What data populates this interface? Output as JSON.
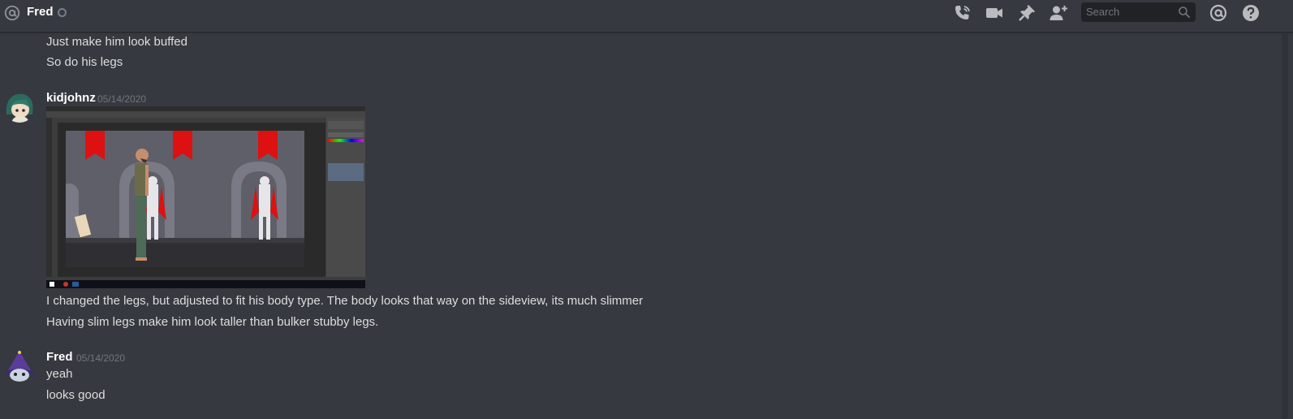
{
  "header": {
    "channel_name": "Fred",
    "search_placeholder": "Search",
    "icons": [
      "at-icon",
      "phone-call-icon",
      "video-icon",
      "pin-icon",
      "add-friend-icon",
      "search-icon",
      "mentions-icon",
      "help-icon"
    ]
  },
  "messages": {
    "prev_lines": [
      "Just make him look buffed",
      "So do his legs"
    ],
    "group1": {
      "username": "kidjohnz",
      "timestamp": "05/14/2020",
      "attachment_icon": "photoshop-screenshot-image",
      "lines": [
        "I changed the legs, but adjusted to fit his body type. The body looks that way on the sideview, its much slimmer",
        "Having slim legs make him look taller than bulker stubby legs."
      ]
    },
    "group2": {
      "username": "Fred",
      "timestamp": "05/14/2020",
      "lines": [
        "yeah",
        "looks good"
      ]
    }
  },
  "colors": {
    "background": "#36393f",
    "text": "#dcddde",
    "muted": "#72767d",
    "search_bg": "#202225"
  }
}
